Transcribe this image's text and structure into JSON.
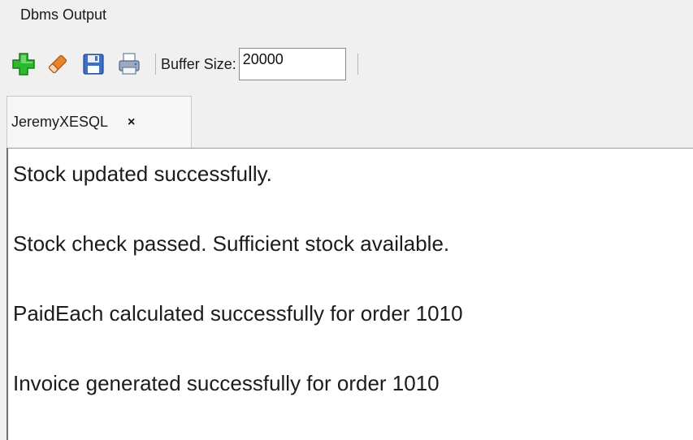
{
  "panel": {
    "title": "Dbms Output"
  },
  "toolbar": {
    "icons": {
      "enable": "add-icon",
      "clear": "eraser-icon",
      "save": "save-icon",
      "print": "print-icon"
    },
    "buffer_label": "Buffer Size:",
    "buffer_value": "20000"
  },
  "tabs": [
    {
      "label": "JeremyXESQL",
      "close_glyph": "×"
    }
  ],
  "output": {
    "lines": [
      "Stock updated successfully.",
      "Stock check passed. Sufficient stock available.",
      "PaidEach calculated successfully for order 1010",
      "Invoice generated successfully for order 1010"
    ]
  },
  "colors": {
    "add_green": "#2eb82e",
    "eraser_orange": "#e8842a",
    "save_blue": "#3c6fc7",
    "panel_bg": "#f0f0f0",
    "output_bg": "#ffffff"
  }
}
